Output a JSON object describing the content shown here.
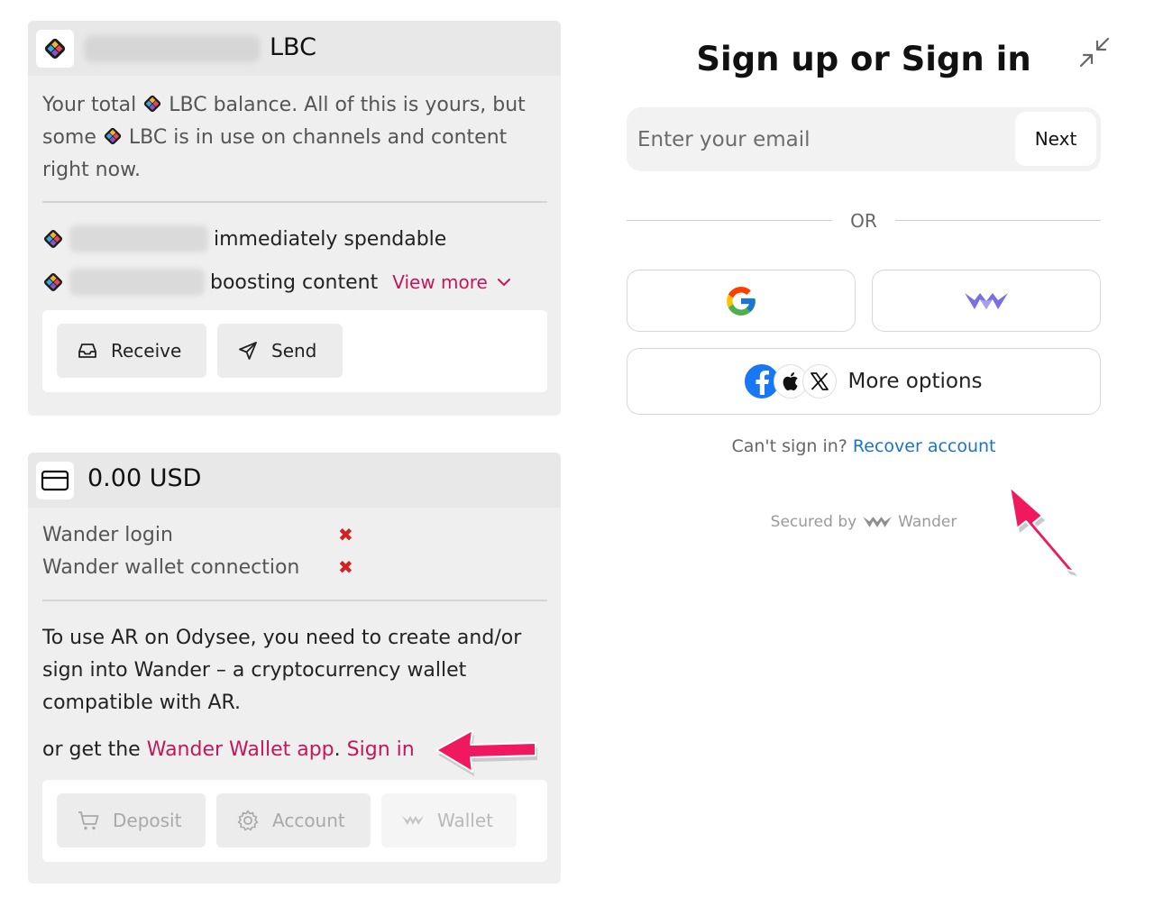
{
  "lbc_card": {
    "title": "LBC",
    "desc_1": "Your total ",
    "desc_2": " LBC balance. All of this is yours, but some ",
    "desc_3": " LBC is in use on channels and content right now.",
    "rows": [
      {
        "label": "immediately spendable"
      },
      {
        "label": "boosting content"
      }
    ],
    "view_more": "View more",
    "receive_label": "Receive",
    "send_label": "Send"
  },
  "usd_card": {
    "title": "0.00 USD",
    "status": [
      {
        "label": "Wander login",
        "mark": "✖"
      },
      {
        "label": "Wander wallet connection",
        "mark": "✖"
      }
    ],
    "body": "To use AR on Odysee, you need to create and/or sign into Wander – a cryptocurrency wallet compatible with AR.",
    "cta_prefix": "or get the ",
    "cta_app_link": "Wander Wallet app",
    "cta_sep": ". ",
    "cta_signin": "Sign in",
    "deposit_label": "Deposit",
    "account_label": "Account",
    "wallet_label": "Wallet"
  },
  "signin": {
    "title": "Sign up or Sign in",
    "email_placeholder": "Enter your email",
    "next_label": "Next",
    "or_label": "OR",
    "more_options_label": "More options",
    "cant_signin": "Can't sign in?",
    "recover_label": "Recover account",
    "secured_label": "Secured by",
    "brand_label": "Wander"
  },
  "colors": {
    "accent_pink": "#c2185b",
    "link_blue": "#1a73c8",
    "error_red": "#d32020",
    "arrow_pink": "#f0195f"
  },
  "icons": [
    "lbc-icon",
    "credit-card-icon",
    "inbox-icon",
    "send-icon",
    "chevron-down-icon",
    "cart-icon",
    "gear-icon",
    "wander-icon",
    "collapse-icon",
    "google-icon",
    "facebook-icon",
    "apple-icon",
    "x-icon",
    "annotation-arrow"
  ]
}
